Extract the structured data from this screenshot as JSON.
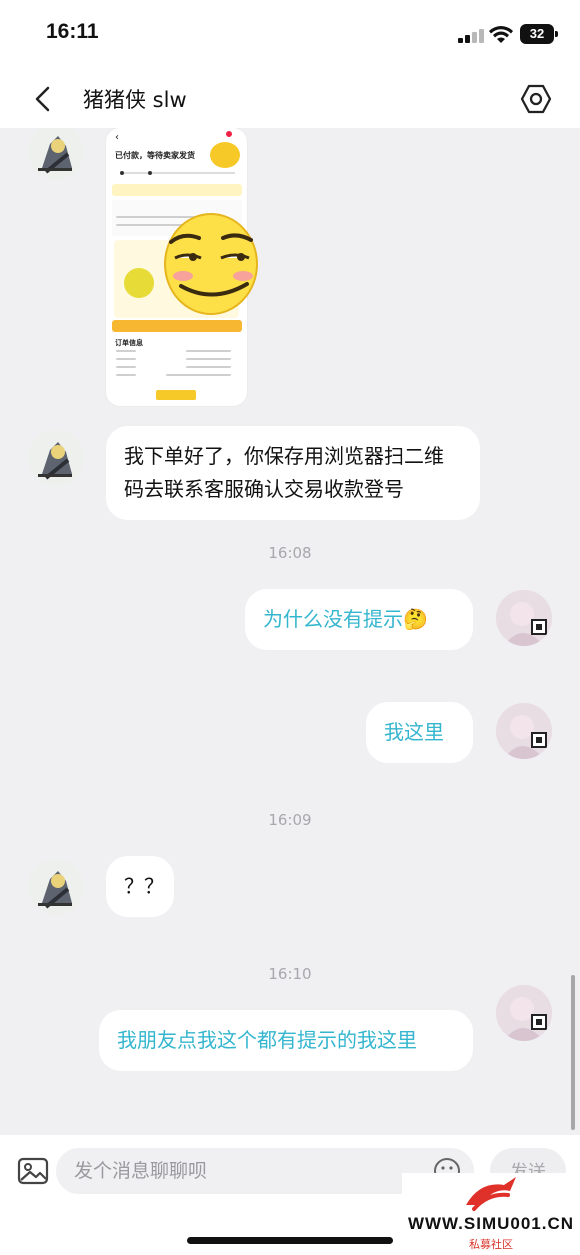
{
  "status_bar": {
    "time": "16:11",
    "battery": "32"
  },
  "header": {
    "title": "猪猪侠 slw"
  },
  "shared_image": {
    "title": "已付款，等待卖家发货",
    "order_section": "订单信息"
  },
  "messages": [
    {
      "side": "left",
      "text": "我下单好了，你保存用浏览器扫二维码去联系客服确认交易收款登号"
    },
    {
      "type": "timestamp",
      "text": "16:08"
    },
    {
      "side": "right",
      "text": "为什么没有提示🤔"
    },
    {
      "side": "right",
      "text": "我这里"
    },
    {
      "type": "timestamp",
      "text": "16:09"
    },
    {
      "side": "left",
      "text": "？？"
    },
    {
      "type": "timestamp",
      "text": "16:10"
    },
    {
      "side": "right",
      "text": "我朋友点我这个都有提示的我这里"
    }
  ],
  "input": {
    "placeholder": "发个消息聊聊呗",
    "send_label": "发送"
  },
  "watermark": {
    "url": "WWW.SIMU001.CN",
    "subtitle": "私募社区"
  },
  "colors": {
    "outgoing_text": "#35b6cf",
    "background": "#f0f0f2"
  }
}
